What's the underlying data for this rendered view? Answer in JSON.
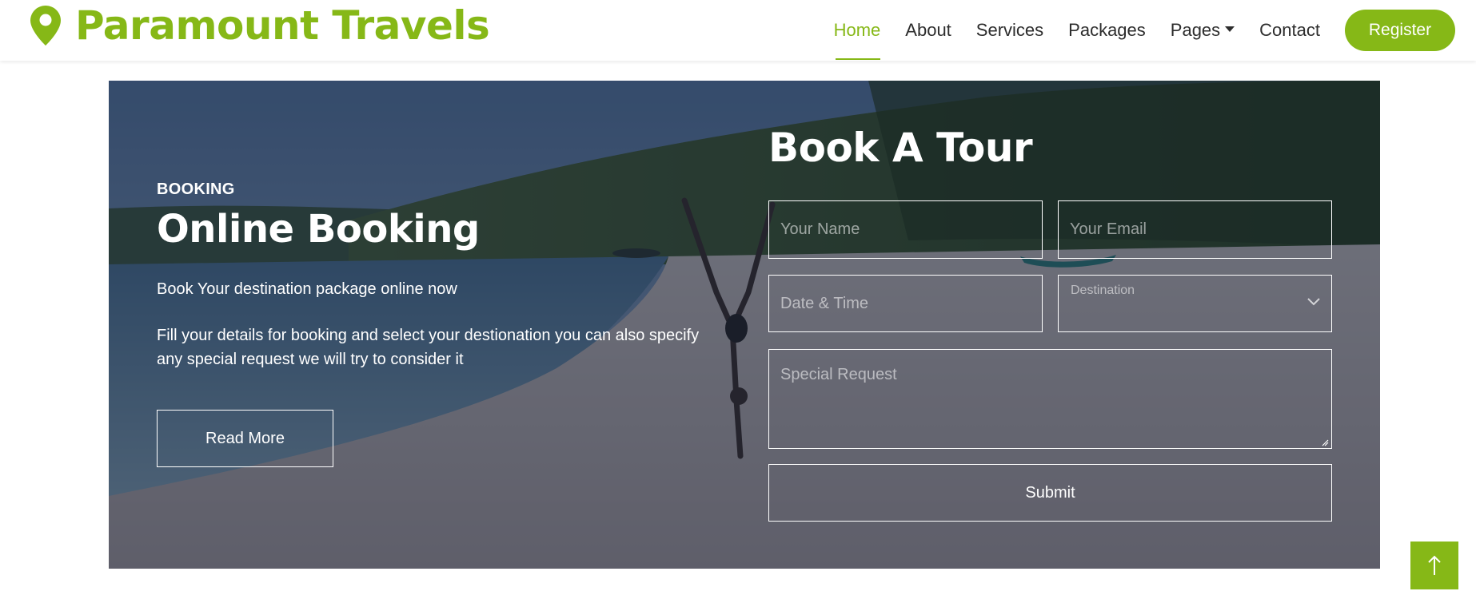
{
  "brand": {
    "name": "Paramount Travels",
    "icon": "map-pin-icon",
    "color": "#86b817"
  },
  "nav": {
    "items": [
      {
        "label": "Home",
        "active": true
      },
      {
        "label": "About"
      },
      {
        "label": "Services"
      },
      {
        "label": "Packages"
      },
      {
        "label": "Pages",
        "dropdown": true
      },
      {
        "label": "Contact"
      }
    ],
    "register_label": "Register"
  },
  "booking": {
    "kicker": "BOOKING",
    "title": "Online Booking",
    "subtitle": "Book Your destination package online now",
    "description": "Fill your details for booking and select your destionation you can also specify any special request we will try to consider it",
    "read_more_label": "Read More"
  },
  "form": {
    "title": "Book A Tour",
    "name_placeholder": "Your Name",
    "email_placeholder": "Your Email",
    "datetime_placeholder": "Date & Time",
    "destination_label": "Destination",
    "request_placeholder": "Special Request",
    "submit_label": "Submit"
  },
  "back_to_top": {
    "icon": "arrow-up-icon"
  }
}
